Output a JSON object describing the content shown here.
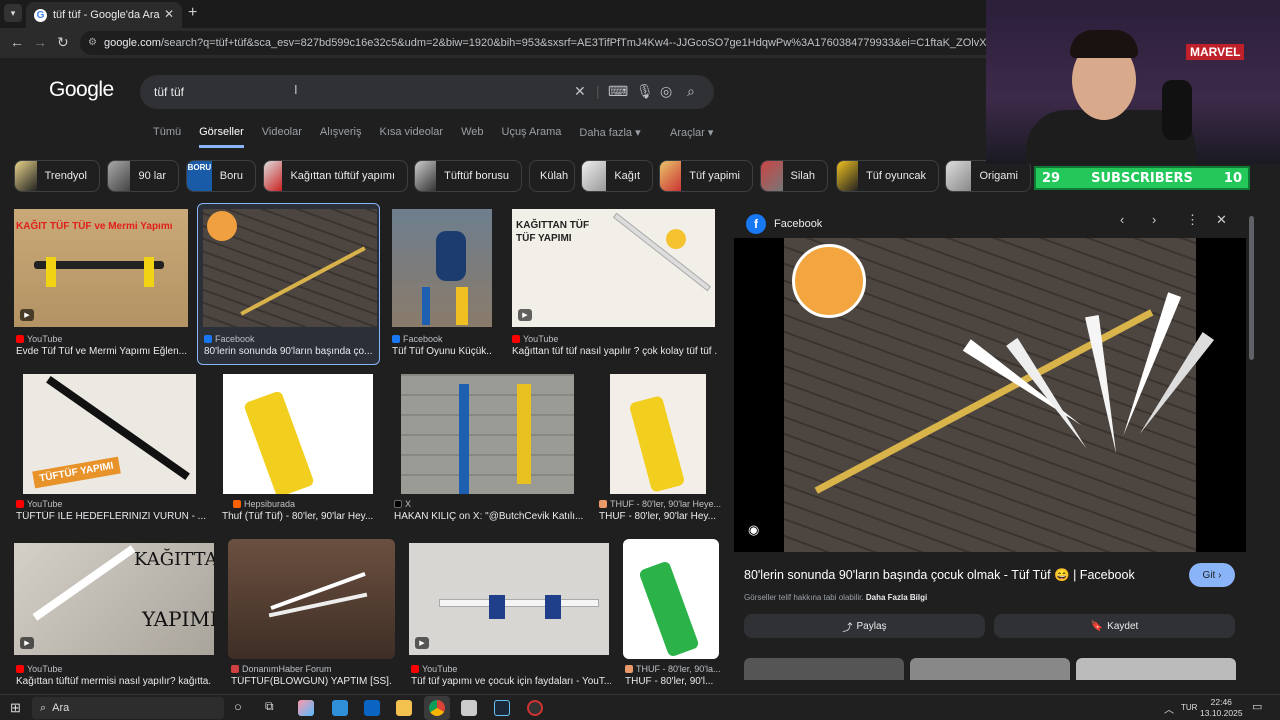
{
  "browser": {
    "tab_title": "tüf tüf - Google'da Ara",
    "tab_favicon": "G",
    "new_tab": "+",
    "url_host": "google.com",
    "url_rest": "/search?q=tüf+tüf&sca_esv=827bd599c16e32c5&udm=2&biw=1920&bih=953&sxsrf=AE3TifPfTmJ4Kw4--JJGcoSO7ge1HdqwPw%3A1760384779933&ei=C1ftaK_ZOlvXxc8PwZutmQg&ved=0ahUKEwjviu"
  },
  "google": {
    "logo": "Google",
    "query": "tüf tüf",
    "nav": [
      "Tümü",
      "Görseller",
      "Videolar",
      "Alışveriş",
      "Kısa videolar",
      "Web",
      "Uçuş Arama",
      "Daha fazla ▾"
    ],
    "active_nav": "Görseller",
    "tools": "Araçlar ▾"
  },
  "chips": [
    "Trendyol",
    "90 lar",
    "Boru",
    "Kağıttan tüftüf yapımı",
    "Tüftüf borusu",
    "Külah",
    "Kağıt",
    "Tüf yapimi",
    "Silah",
    "Tüf oyuncak",
    "Origami"
  ],
  "results": [
    {
      "source": "YouTube",
      "caption": "Evde Tüf Tüf ve Mermi Yapımı Eğlen..."
    },
    {
      "source": "Facebook",
      "caption": "80'lerin sonunda 90'ların başında ço..."
    },
    {
      "source": "Facebook",
      "caption": "Tüf Tüf Oyunu Küçük..."
    },
    {
      "source": "YouTube",
      "caption": "Kağıttan tüf tüf nasıl yapılır ? çok kolay tüf tüf ..."
    },
    {
      "source": "YouTube",
      "caption": "TÜFTÜF İLE HEDEFLERİNİZİ VURUN - ..."
    },
    {
      "source": "Hepsiburada",
      "caption": "Thuf (Tüf Tüf) - 80'ler, 90'lar Hey..."
    },
    {
      "source": "X",
      "caption": "HAKAN KILIÇ on X: \"@ButchCevik Katılı..."
    },
    {
      "source": "THUF - 80'ler, 90'lar Heye...",
      "caption": "THUF - 80'ler, 90'lar Hey..."
    },
    {
      "source": "YouTube",
      "caption": "Kağıttan tüftüf mermisi nasıl yapılır? kağıtta..."
    },
    {
      "source": "DonanımHaber Forum",
      "caption": "TÜFTÜF(BLOWGUN) YAPTIM [SS]..."
    },
    {
      "source": "YouTube",
      "caption": "Tüf tüf yapımı ve çocuk için faydaları - YouT..."
    },
    {
      "source": "THUF - 80'ler, 90'la...",
      "caption": "THUF - 80'ler, 90'l..."
    }
  ],
  "thumb_text": {
    "t1": "KAĞIT TÜF TÜF ve Mermi Yapımı",
    "t4": "KAĞITTAN TÜF TÜF YAPIMI",
    "t5": "TÜFTÜF YAPIMI",
    "t9a": "KAĞITTAN",
    "t9b": "YAPIMI",
    "chip_boru": "BORU"
  },
  "panel": {
    "source": "Facebook",
    "title": "80'lerin sonunda 90'ların başında çocuk olmak - Tüf Tüf 😄 | Facebook",
    "go": "Git ›",
    "copyright": "Görseller telif hakkına tabi olabilir.",
    "more_info": "Daha Fazla Bilgi",
    "share": "Paylaş",
    "save": "Kaydet"
  },
  "overlay": {
    "subs_left": "29",
    "subs_label": "SUBSCRIBERS",
    "subs_right": "10",
    "marvel": "MARVEL"
  },
  "taskbar": {
    "search": "Ara",
    "lang": "TUR",
    "time": "22:46",
    "date": "13.10.2025"
  },
  "colors": {
    "accent": "#8ab4f8",
    "facebook": "#1877f2",
    "youtube": "#ff0000",
    "subs": "#24c85a"
  }
}
